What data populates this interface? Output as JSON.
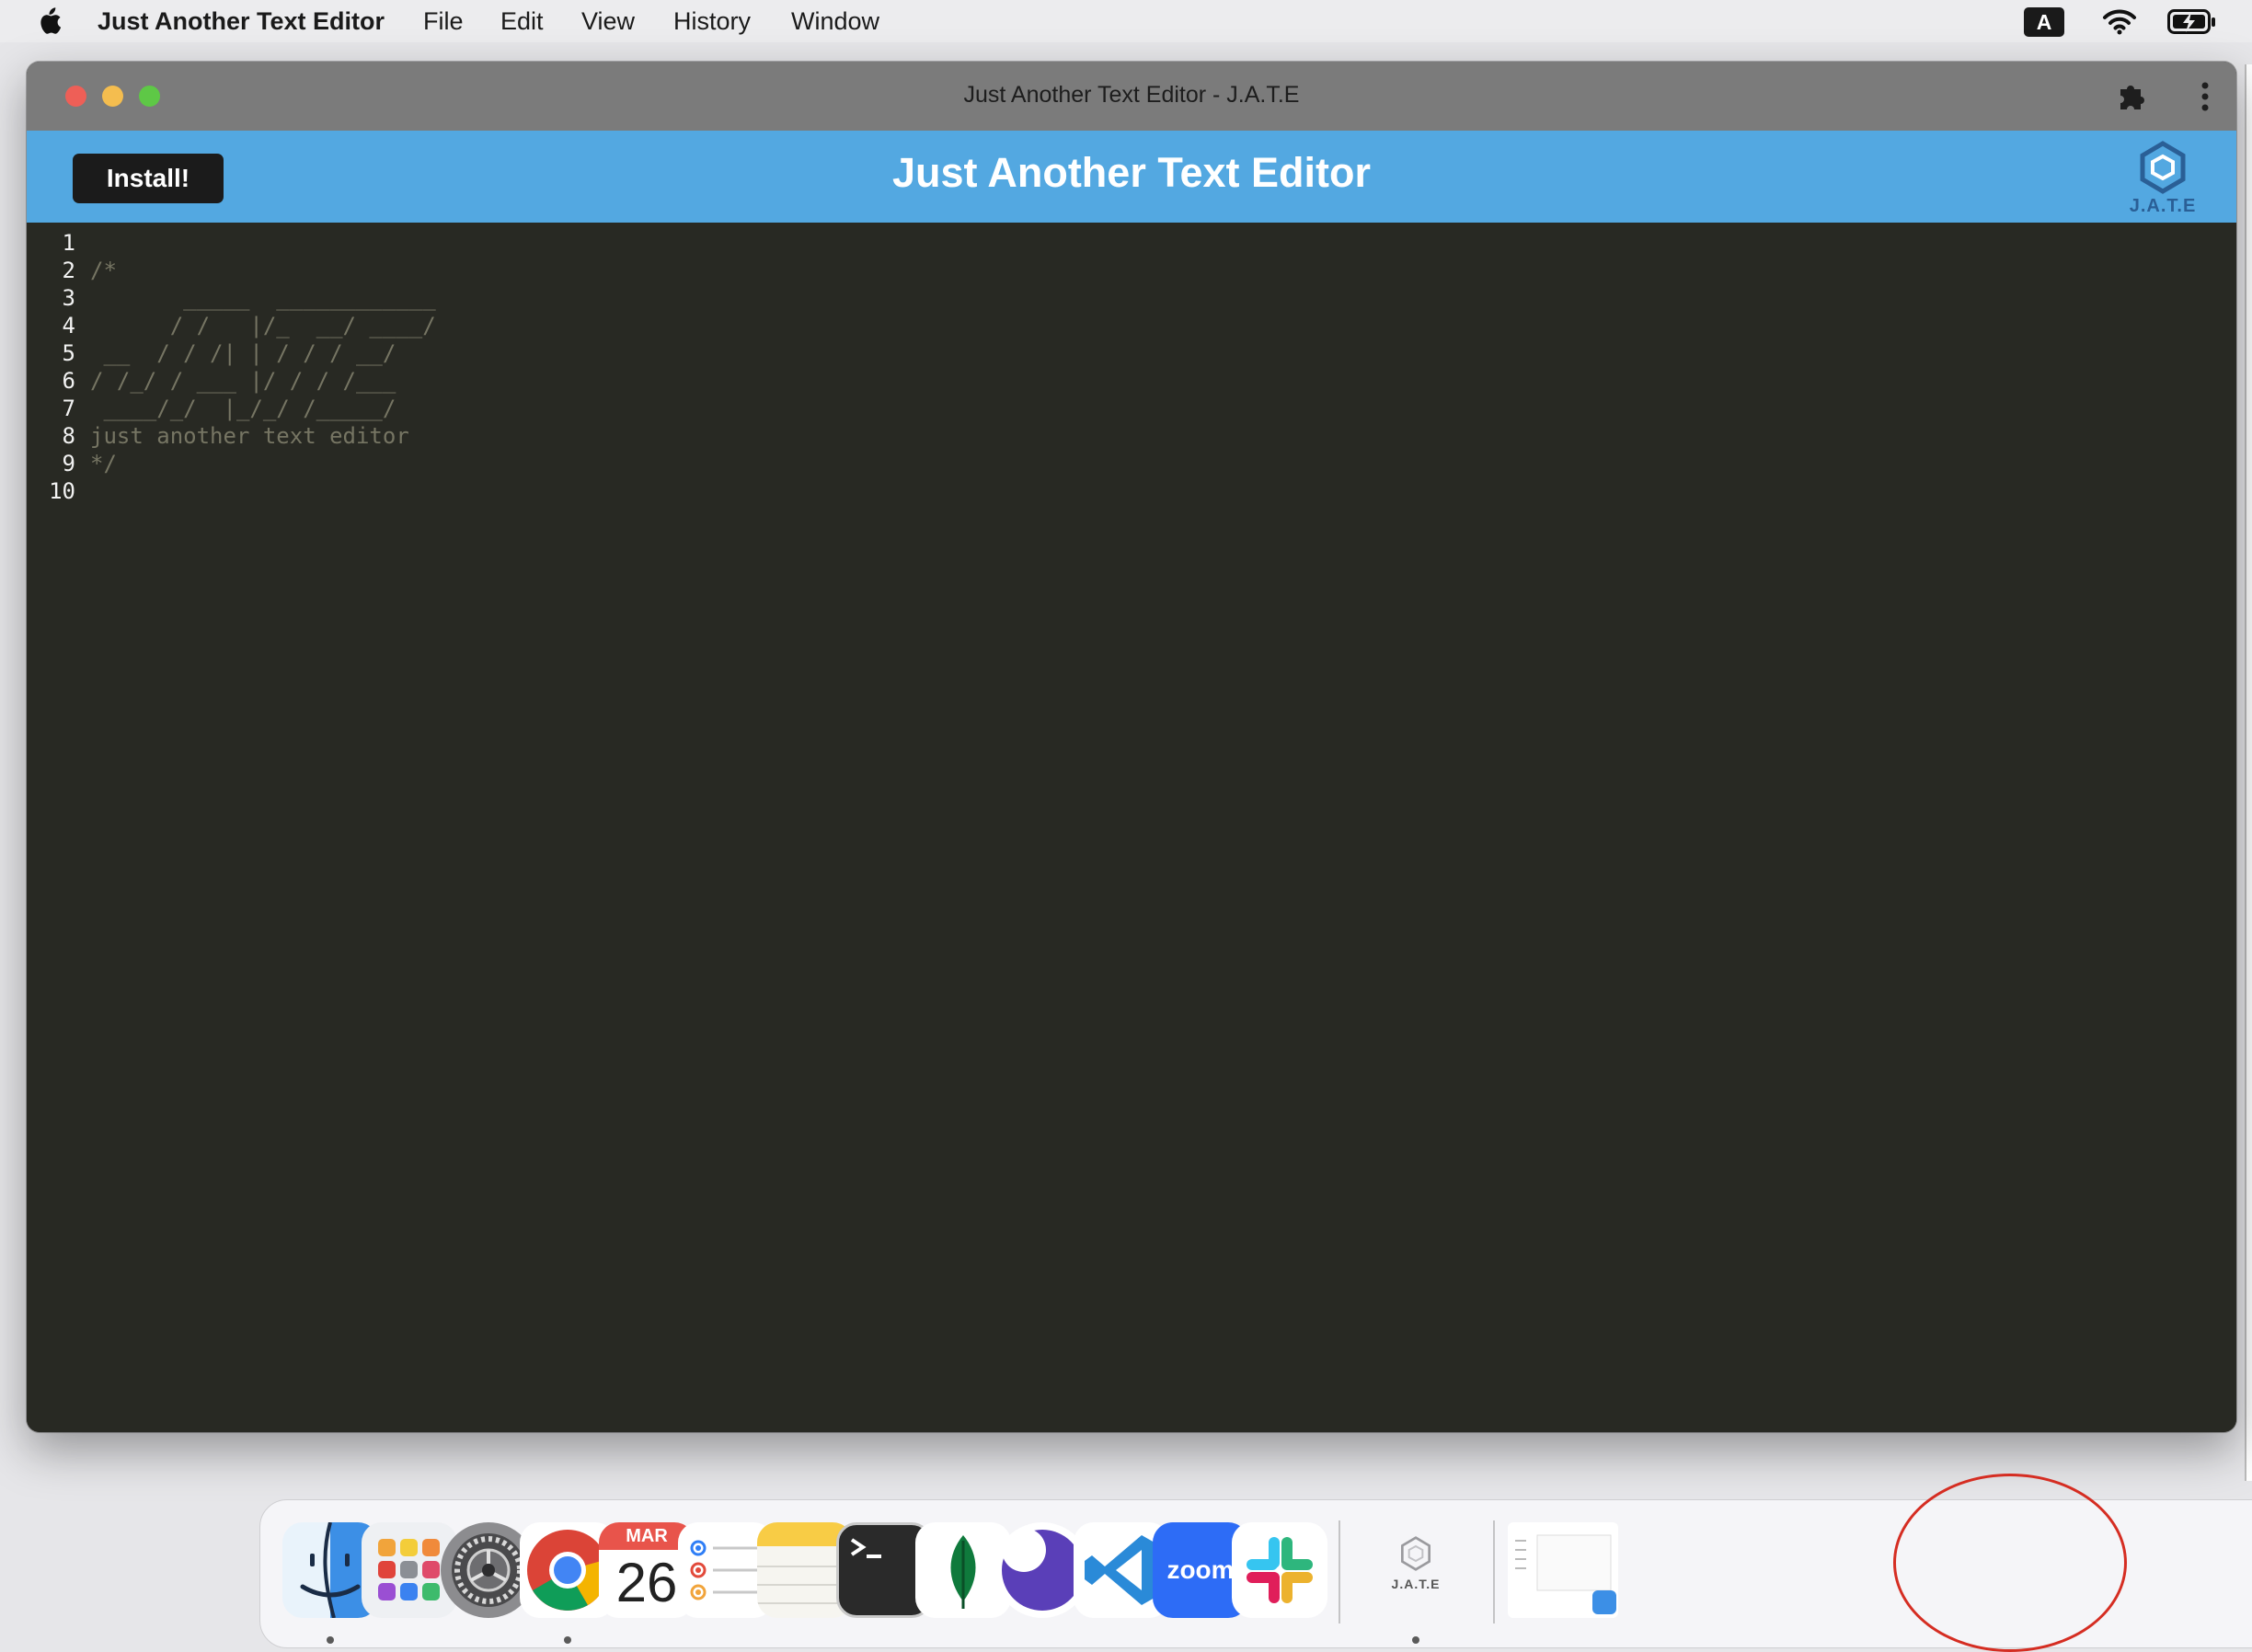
{
  "menubar": {
    "app_name": "Just Another Text Editor",
    "items": [
      "File",
      "Edit",
      "View",
      "History",
      "Window"
    ],
    "input_source": "A"
  },
  "window": {
    "title": "Just Another Text Editor - J.A.T.E"
  },
  "header": {
    "install_label": "Install!",
    "app_title": "Just Another Text Editor",
    "logo_text": "J.A.T.E",
    "background_color": "#53a8e1"
  },
  "editor": {
    "lines": [
      {
        "number": "1",
        "text": ""
      },
      {
        "number": "2",
        "text": "/*"
      },
      {
        "number": "3",
        "text": "       _____  ____________"
      },
      {
        "number": "4",
        "text": "      / /   |/_  __/ ____/"
      },
      {
        "number": "5",
        "text": " __  / / /| | / / / __/"
      },
      {
        "number": "6",
        "text": "/ /_/ / ___ |/ / / /___"
      },
      {
        "number": "7",
        "text": " ____/_/  |_/_/ /_____/"
      },
      {
        "number": "8",
        "text": "just another text editor"
      },
      {
        "number": "9",
        "text": "*/"
      },
      {
        "number": "10",
        "text": ""
      }
    ],
    "background_color": "#282923"
  },
  "dock": {
    "apps": [
      {
        "name": "Finder",
        "icon": "finder-icon"
      },
      {
        "name": "Launchpad",
        "icon": "launchpad-icon"
      },
      {
        "name": "System Preferences",
        "icon": "gear-icon"
      },
      {
        "name": "Google Chrome",
        "icon": "chrome-icon"
      },
      {
        "name": "Calendar",
        "icon": "calendar-icon",
        "month": "MAR",
        "day": "26"
      },
      {
        "name": "Reminders",
        "icon": "reminders-icon"
      },
      {
        "name": "Notes",
        "icon": "notes-icon"
      },
      {
        "name": "Terminal",
        "icon": "terminal-icon"
      },
      {
        "name": "MongoDB Compass",
        "icon": "mongodb-leaf-icon"
      },
      {
        "name": "Insomnia",
        "icon": "insomnia-icon"
      },
      {
        "name": "Visual Studio Code",
        "icon": "vscode-icon"
      },
      {
        "name": "Zoom",
        "icon": "zoom-icon",
        "label": "zoom"
      },
      {
        "name": "Slack",
        "icon": "slack-icon"
      },
      {
        "name": "J.A.T.E",
        "icon": "jate-icon",
        "label": "J.A.T.E"
      }
    ]
  }
}
